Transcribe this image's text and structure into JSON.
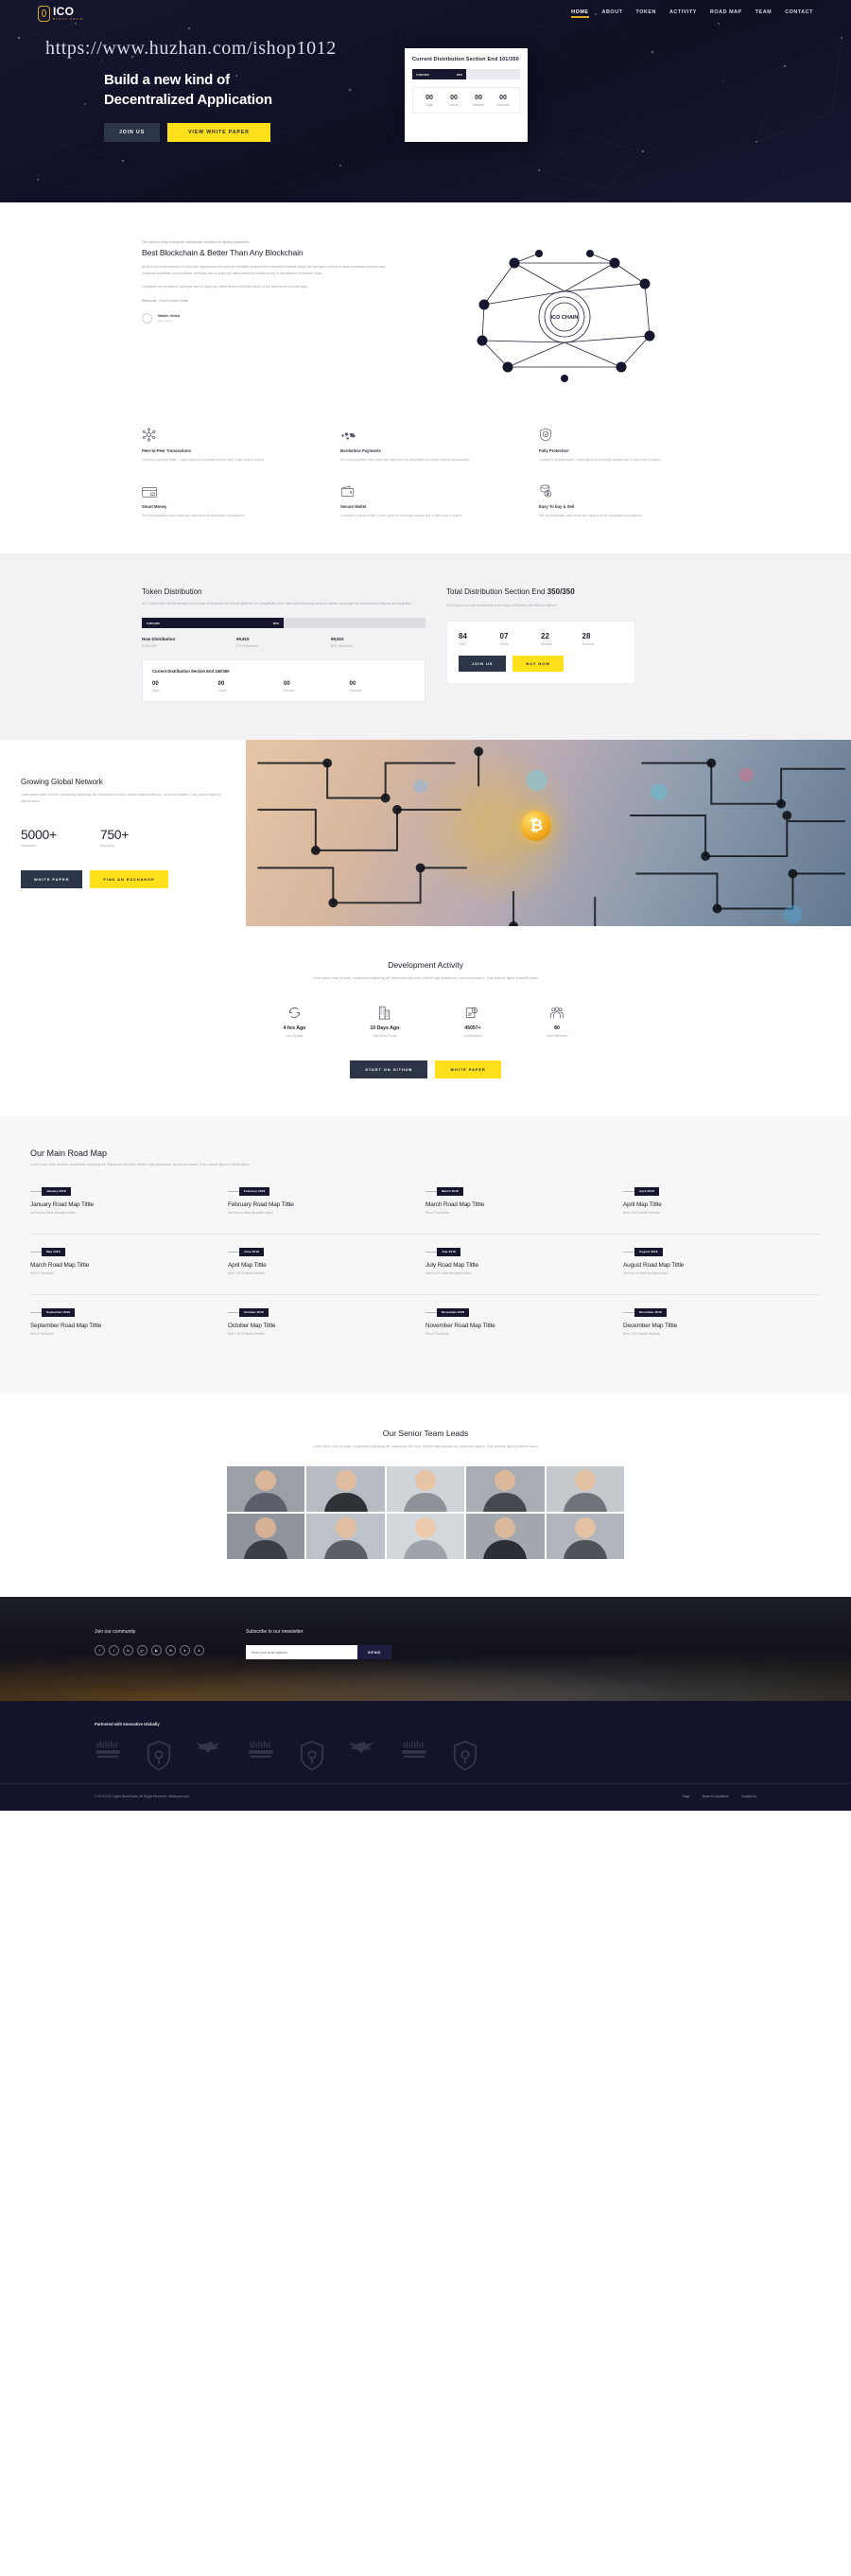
{
  "brand": {
    "name": "ICO",
    "tagline": "BLOCK CHAIN"
  },
  "nav": {
    "items": [
      {
        "label": "HOME",
        "active": true
      },
      {
        "label": "ABOUT",
        "active": false
      },
      {
        "label": "TOKEN",
        "active": false
      },
      {
        "label": "ACTIVITY",
        "active": false
      },
      {
        "label": "ROAD MAP",
        "active": false
      },
      {
        "label": "TEAM",
        "active": false
      },
      {
        "label": "CONTACT",
        "active": false
      }
    ]
  },
  "watermark": "https://www.huzhan.com/ishop1012",
  "hero": {
    "title_line1": "Build a new kind of",
    "title_line2": "Decentralized Application",
    "btn_join": "JOIN US",
    "btn_whitepaper": "VIEW WHITE PAPER",
    "card": {
      "title": "Current Distribution Section End 101/350",
      "progress_amount": "5,000,000",
      "progress_percent": "50%",
      "countdown": [
        {
          "value": "00",
          "label": "Days"
        },
        {
          "value": "00",
          "label": "Hours"
        },
        {
          "value": "00",
          "label": "Minutes"
        },
        {
          "value": "00",
          "label": "Seconds"
        }
      ]
    }
  },
  "about": {
    "eyebrow": "The world's only enterprise blockchain solution for global payments",
    "heading": "Best Blockchain & Better Than Any Blockchain",
    "para1": "At vero eos et accusamus et iusto odio dignissimos ducimus qui blanditiis praesentium voluptatum deleniti atque corrupti quos dolores et quas molestias excepturi sint occaecati cupiditate non provident, similique sunt in culpa qui officia deserunt mollitia animi, id est laborum et dolorum fuga.",
    "para2": "Cupiditate non provident, similique sunt in culpa qui officia deserunt mollitia animi, id est laborum et dolorum fuga.",
    "byline": "Webicode  -  Ceo/Founder Chain",
    "watch_title": "Watch Video",
    "watch_sub": "How it work",
    "diagram_label": "ICO CHAIN"
  },
  "features": [
    {
      "icon": "network-node-icon",
      "title": "Peer-to-Peer Transactions",
      "text": "Contrary to popular belief , Lorem ipsum is not simply random text. It has roots in a piece"
    },
    {
      "icon": "world-map-icon",
      "title": "Borderless Payments",
      "text": "Sed ut perspiciatis unde omnis iste natus error sit voluptatem not simply random accusantium"
    },
    {
      "icon": "shield-check-icon",
      "title": "Fully Protection",
      "text": "Contrary to popular belief, Lorem ipsum is not simply random text. It has roots in a piece"
    },
    {
      "icon": "credit-card-icon",
      "title": "Smart Money",
      "text": "Sed ut perspiciatis unde omnis iste natus error sit voluptatem accusantium"
    },
    {
      "icon": "wallet-icon",
      "title": "Secure Wallet",
      "text": "Contrary to popular belief, Lorem ipsum is not simply random text. It has roots in a piece"
    },
    {
      "icon": "coins-icon",
      "title": "Easy To buy & Sell",
      "text": "Sed ut perspiciatis unde omnis iste natus error sit voluptatem accusantium"
    }
  ],
  "token": {
    "left": {
      "heading": "Token Distribution",
      "desc": "ICO Crypto token will be released on the basis of Ethereum and Bitocin platform. It's compatibility of the token with third-party services wallets, exchanges etc, and provides easy-to-use integration.",
      "progress_amount": "5,000,000",
      "progress_percent": "50%",
      "stats": [
        {
          "top": "Now Distribution",
          "bottom": "2,000,000"
        },
        {
          "top": "99,910",
          "bottom": "ETH Received"
        },
        {
          "top": "99,910",
          "bottom": "BTC Received"
        }
      ],
      "card_title": "Current Distribution Section End 150/350",
      "countdown": [
        {
          "value": "00",
          "label": "Days"
        },
        {
          "value": "00",
          "label": "Hours"
        },
        {
          "value": "00",
          "label": "Minutes"
        },
        {
          "value": "00",
          "label": "Seconds"
        }
      ]
    },
    "right": {
      "heading_pre": "Total Distribution Section End ",
      "heading_bold": "350/350",
      "desc": "ICO Crypto token will be released on the basis of Ethereum and Bitocin platform.",
      "countdown": [
        {
          "value": "84",
          "label": "Days"
        },
        {
          "value": "07",
          "label": "Hours"
        },
        {
          "value": "22",
          "label": "Minutes"
        },
        {
          "value": "28",
          "label": "Seconds"
        }
      ],
      "btn_join": "JOIN US",
      "btn_buy": "BUY NOW"
    }
  },
  "network": {
    "heading": "Growing Global Network",
    "desc": "Lorem ipsum dolor sit amet, consectetur adipiscing elit. Maecenas nibh dolor, efficitur eget pharetra ac, cursus sed sapien. Cras posuere ligula ut blandit varius.",
    "stats": [
      {
        "number": "5000+",
        "label": "Customers"
      },
      {
        "number": "750+",
        "label": "Deploying"
      }
    ],
    "btn_whitepaper": "WHITE PAPER",
    "btn_exchange": "FIND AN EXCHANGE"
  },
  "dev": {
    "heading": "Development Activity",
    "desc": "Lorem ipsum dolor sit amet, consectetur adipiscing elit. Maecenas nibh dolor, efficitur eget pharetra ac, cursus sed sapien. Cras posuere ligula ut blandit varius.",
    "items": [
      {
        "icon": "refresh-icon",
        "number": "4 hrs Ago",
        "label": "Last Update"
      },
      {
        "icon": "building-icon",
        "number": "10 Days Ago",
        "label": "Last Block Found"
      },
      {
        "icon": "contribution-icon",
        "number": "45057+",
        "label": "Contributions"
      },
      {
        "icon": "team-icon",
        "number": "80",
        "label": "Team Members"
      }
    ],
    "btn_github": "START ON GITHUB",
    "btn_whitepaper": "WHITE PAPER"
  },
  "roadmap": {
    "heading": "Our Main Road Map",
    "desc": "Lorem ipsum dolor sit amet, consectetur adipiscing elit. Maecenas nibh dolor, efficitur eget pharetra ac, cursus sed sapien. Cras posuere ligula ut blandit varius.",
    "items": [
      {
        "badge": "January 2018",
        "title": "January Road Map Tittle",
        "sub": "1st Prize for Best Illustration Artist"
      },
      {
        "badge": "February 2018",
        "title": "February Road Map Tittle",
        "sub": "1st Prize for Best Illustration Artist"
      },
      {
        "badge": "March 2018",
        "title": "March Road Map Tittle",
        "sub": "Site of The Month"
      },
      {
        "badge": "April 2018",
        "title": "April Map Tittle",
        "sub": "Best CSS Portfolio Website"
      },
      {
        "badge": "May 2018",
        "title": "March Road Map Tittle",
        "sub": "Site of The Month"
      },
      {
        "badge": "June 2018",
        "title": "April Map Tittle",
        "sub": "Best CSS Portfolio Website"
      },
      {
        "badge": "July 2018",
        "title": "July Road Map Tittle",
        "sub": "1st Prize for Best Illustration Artist"
      },
      {
        "badge": "August 2018",
        "title": "August Road Map Tittle",
        "sub": "1st Prize for Best Illustration Artist"
      },
      {
        "badge": "September 2018",
        "title": "September Road Map Tittle",
        "sub": "Site of The Month"
      },
      {
        "badge": "October 2018",
        "title": "October Map Tittle",
        "sub": "Best CSS Portfolio Website"
      },
      {
        "badge": "November 2018",
        "title": "November Road Map Tittle",
        "sub": "Site of The Month"
      },
      {
        "badge": "December 2018",
        "title": "December Map Tittle",
        "sub": "Best CSS Portfolio Website"
      }
    ]
  },
  "team": {
    "heading": "Our Senior Team Leads",
    "desc": "Lorem ipsum dolor sit amet, consectetur adipiscing elit. Maecenas nibh dolor, efficitur eget pharetra ac, cursus sed sapien. Cras posuere ligula ut blandit varius."
  },
  "cta": {
    "community_title": "Join our community",
    "newsletter_title": "Subscribe to our newsletter",
    "email_placeholder": "Enter your email address",
    "send_label": "SEND",
    "socials": [
      "f",
      "t",
      "in",
      "g+",
      "▶",
      "✉",
      "●",
      "●"
    ]
  },
  "partners": {
    "title": "Partnered with Innovative Globally",
    "logos": [
      "jefferson-wordmark",
      "shield-crest",
      "eagle-wings",
      "jefferson-wordmark",
      "shield-crest",
      "eagle-wings",
      "jefferson-wordmark",
      "shield-crest"
    ]
  },
  "footer": {
    "copyright": "© 2018 ICO Crypto BlockChain, All Rights Reserved. Webicode.com",
    "links": [
      "Faqs",
      "Terms & Conditions",
      "Contact Us"
    ]
  },
  "colors": {
    "dark": "#16162e",
    "gold": "#d4aa2e",
    "yellow": "#ffe01b",
    "slate": "#2d3648"
  }
}
